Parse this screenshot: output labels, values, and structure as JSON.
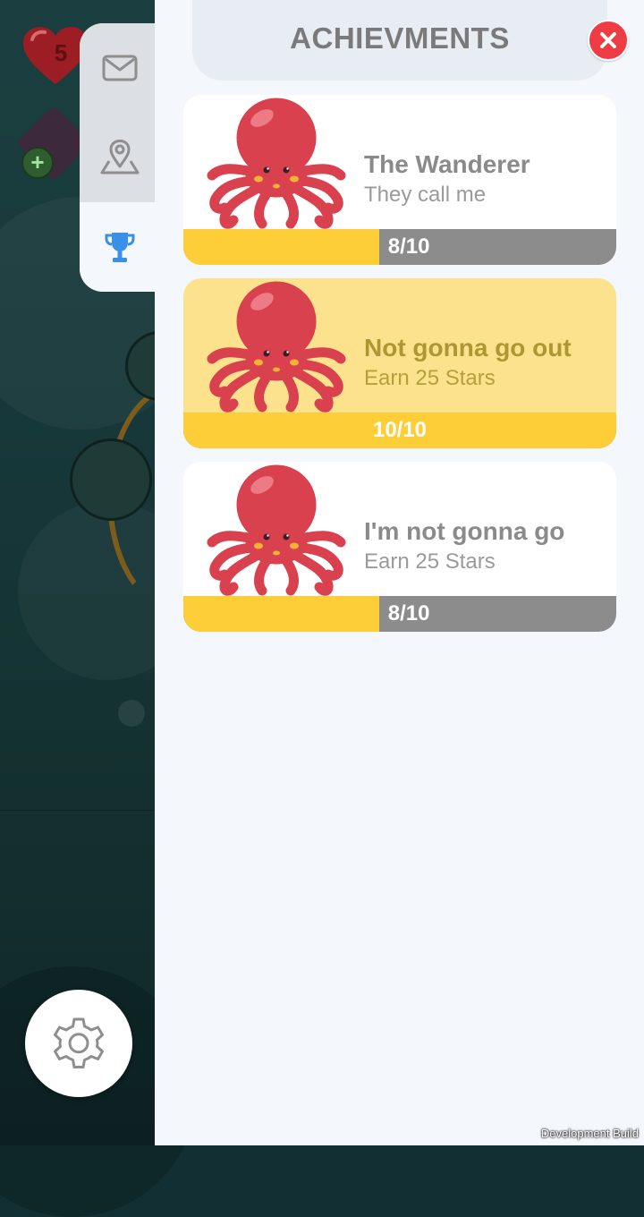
{
  "hud": {
    "lives_count": "5"
  },
  "tabs": [
    {
      "id": "inbox",
      "icon": "mail-icon",
      "active": false
    },
    {
      "id": "map",
      "icon": "map-pin-icon",
      "active": false
    },
    {
      "id": "achievements",
      "icon": "trophy-icon",
      "active": true
    }
  ],
  "header": {
    "title": "ACHIEVMENTS",
    "close_icon": "close-icon"
  },
  "achievements": [
    {
      "title": "The Wanderer",
      "description": "They call me",
      "progress_text": "8/10",
      "progress": 0.8,
      "completed": false
    },
    {
      "title": "Not gonna go out",
      "description": "Earn 25 Stars",
      "progress_text": "10/10",
      "progress": 1.0,
      "completed": true
    },
    {
      "title": "I'm not gonna go",
      "description": "Earn 25 Stars",
      "progress_text": "8/10",
      "progress": 0.8,
      "completed": false
    }
  ],
  "footer": {
    "build_label": "Development Build",
    "settings_icon": "gear-icon"
  },
  "colors": {
    "accent_yellow": "#fece39",
    "close_red": "#ee3b44",
    "active_tab_icon": "#3a8fe6",
    "octopus_red": "#d9414f"
  }
}
